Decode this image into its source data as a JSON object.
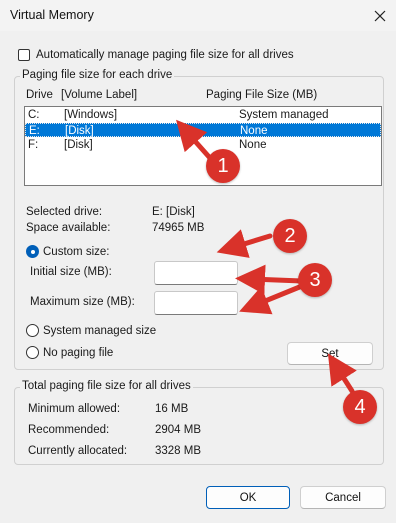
{
  "window": {
    "title": "Virtual Memory"
  },
  "auto_manage": {
    "label": "Automatically manage paging file size for all drives",
    "checked": false
  },
  "paging_group": {
    "legend": "Paging file size for each drive",
    "headers": {
      "drive": "Drive",
      "volume_label": "[Volume Label]",
      "paging_size": "Paging File Size (MB)"
    },
    "rows": [
      {
        "drive": "C:",
        "label": "[Windows]",
        "size": "System managed",
        "selected": false
      },
      {
        "drive": "E:",
        "label": "[Disk]",
        "size": "None",
        "selected": true
      },
      {
        "drive": "F:",
        "label": "[Disk]",
        "size": "None",
        "selected": false
      }
    ],
    "selected_drive_label": "Selected drive:",
    "selected_drive_value": "E:  [Disk]",
    "space_available_label": "Space available:",
    "space_available_value": "74965 MB",
    "custom_size_label": "Custom size:",
    "initial_size_label": "Initial size (MB):",
    "initial_size_value": "",
    "maximum_size_label": "Maximum size (MB):",
    "maximum_size_value": "",
    "system_managed_label": "System managed size",
    "no_paging_label": "No paging file",
    "set_button": "Set",
    "selected_option": "custom"
  },
  "total_group": {
    "legend": "Total paging file size for all drives",
    "minimum_label": "Minimum allowed:",
    "minimum_value": "16 MB",
    "recommended_label": "Recommended:",
    "recommended_value": "2904 MB",
    "allocated_label": "Currently allocated:",
    "allocated_value": "3328 MB"
  },
  "buttons": {
    "ok": "OK",
    "cancel": "Cancel"
  },
  "annotations": {
    "color": "#d9322a",
    "badges": [
      "1",
      "2",
      "3",
      "4"
    ]
  }
}
